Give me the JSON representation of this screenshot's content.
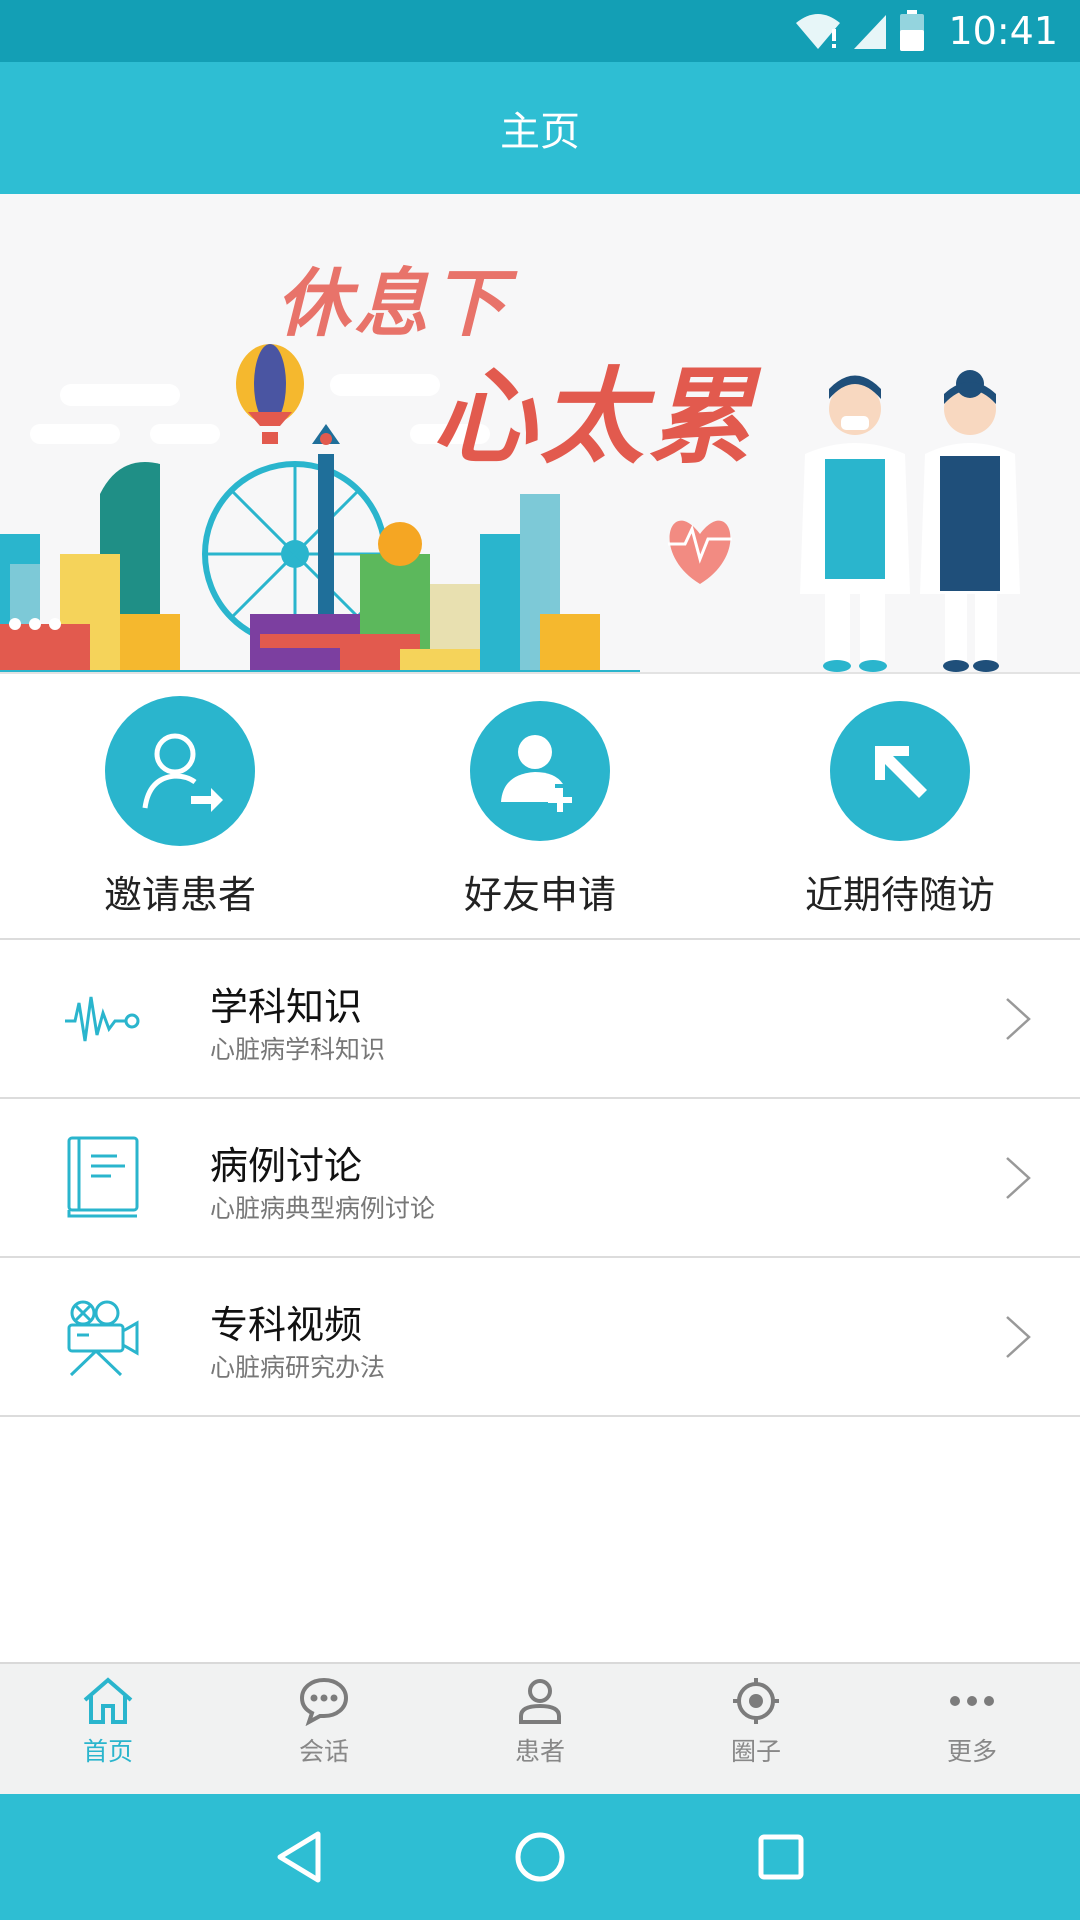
{
  "status_bar": {
    "time": "10:41"
  },
  "header": {
    "title": "主页"
  },
  "banner": {
    "line1": "休息下",
    "line2": "心太累"
  },
  "quick_actions": [
    {
      "label": "邀请患者",
      "icon": "invite-patient-icon"
    },
    {
      "label": "好友申请",
      "icon": "friend-request-icon"
    },
    {
      "label": "近期待随访",
      "icon": "follow-up-arrow-icon"
    }
  ],
  "menu": [
    {
      "title": "学科知识",
      "subtitle": "心脏病学科知识",
      "icon": "heartbeat-wave-icon"
    },
    {
      "title": "病例讨论",
      "subtitle": "心脏病典型病例讨论",
      "icon": "book-icon"
    },
    {
      "title": "专科视频",
      "subtitle": "心脏病研究办法",
      "icon": "video-camera-icon"
    }
  ],
  "bottom_nav": [
    {
      "label": "首页",
      "icon": "home-icon",
      "active": true
    },
    {
      "label": "会话",
      "icon": "chat-bubble-icon",
      "active": false
    },
    {
      "label": "患者",
      "icon": "person-icon",
      "active": false
    },
    {
      "label": "圈子",
      "icon": "target-icon",
      "active": false
    },
    {
      "label": "更多",
      "icon": "more-dots-icon",
      "active": false
    }
  ],
  "colors": {
    "accent": "#2ab5cd",
    "header": "#2ebed3",
    "status_bar": "#139fb5",
    "banner_text": "#e25a4e"
  }
}
